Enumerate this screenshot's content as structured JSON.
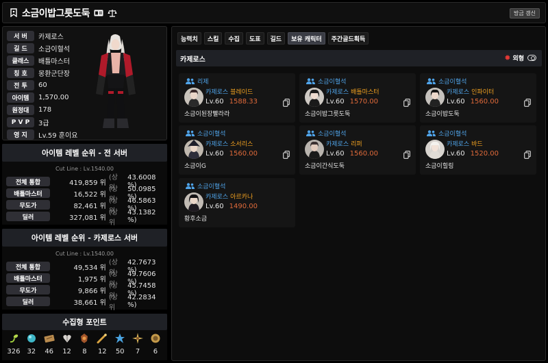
{
  "header": {
    "title": "소금이밥그릇도둑",
    "update_label": "방금 갱신"
  },
  "profile": {
    "rows": [
      {
        "label": "서 버",
        "value": "카제로스"
      },
      {
        "label": "길 드",
        "value": "소금이혈석"
      },
      {
        "label": "클래스",
        "value": "배틀마스터"
      },
      {
        "label": "칭 호",
        "value": "몽환군단장"
      },
      {
        "label": "전 투",
        "value": "60"
      },
      {
        "label": "아이템",
        "value": "1,570.00"
      },
      {
        "label": "원정대",
        "value": "178"
      },
      {
        "label": "P V P",
        "value": "3급"
      },
      {
        "label": "영 지",
        "value": "Lv.59 훈이요"
      }
    ]
  },
  "rank_all": {
    "title": "아이템 레벨 순위 - 전 서버",
    "cutline": "Cut Line : Lv.1540.00",
    "rows": [
      {
        "label": "전체 통합",
        "value": "419,859 위",
        "pre": "(상위",
        "pct": "43.6008 %)"
      },
      {
        "label": "배틀마스터",
        "value": "16,522 위",
        "pre": "(상위",
        "pct": "50.0985 %)"
      },
      {
        "label": "무도가",
        "value": "82,461 위",
        "pre": "(상위",
        "pct": "46.5863 %)"
      },
      {
        "label": "딜러",
        "value": "327,081 위",
        "pre": "(상위",
        "pct": "43.1382 %)"
      }
    ]
  },
  "rank_server": {
    "title": "아이템 레벨 순위 - 카제로스 서버",
    "cutline": "Cut Line : Lv.1540.00",
    "rows": [
      {
        "label": "전체 통합",
        "value": "49,534 위",
        "pre": "(상위",
        "pct": "42.7673 %)"
      },
      {
        "label": "배틀마스터",
        "value": "1,975 위",
        "pre": "(상위",
        "pct": "49.7606 %)"
      },
      {
        "label": "무도가",
        "value": "9,866 위",
        "pre": "(상위",
        "pct": "45.7458 %)"
      },
      {
        "label": "딜러",
        "value": "38,661 위",
        "pre": "(상위",
        "pct": "42.2834 %)"
      }
    ]
  },
  "collection": {
    "title": "수집형 포인트",
    "items": [
      {
        "icon": "mokoko-seed-icon",
        "count": "326"
      },
      {
        "icon": "island-soul-icon",
        "count": "32"
      },
      {
        "icon": "art-icon",
        "count": "46"
      },
      {
        "icon": "giant-heart-icon",
        "count": "12"
      },
      {
        "icon": "ignea-token-icon",
        "count": "8"
      },
      {
        "icon": "sea-bounty-icon",
        "count": "12"
      },
      {
        "icon": "world-tree-leaf-icon",
        "count": "50"
      },
      {
        "icon": "orpheus-star-icon",
        "count": "7"
      },
      {
        "icon": "omnium-star-icon",
        "count": "6"
      }
    ]
  },
  "tabs": [
    "능력치",
    "스킬",
    "수집",
    "도표",
    "길드",
    "보유 캐릭터",
    "주간골드획득"
  ],
  "server_bar": {
    "name": "카제로스",
    "ext_label": "외형"
  },
  "characters": [
    {
      "guild": "리제",
      "server": "카제로스",
      "class": "블레이드",
      "level": "Lv.60",
      "ilvl": "1588.33",
      "name": "소금이된장빨라라",
      "portrait": "#c9c3bb"
    },
    {
      "guild": "소금이혈석",
      "server": "카제로스",
      "class": "배틀마스터",
      "level": "Lv.60",
      "ilvl": "1570.00",
      "name": "소금이밥그릇도둑",
      "portrait": "#cfcac4"
    },
    {
      "guild": "소금이혈석",
      "server": "카제로스",
      "class": "인파이터",
      "level": "Lv.60",
      "ilvl": "1560.00",
      "name": "소금이밥도둑",
      "portrait": "#c6c2bd"
    },
    {
      "guild": "소금이혈석",
      "server": "카제로스",
      "class": "소서리스",
      "level": "Lv.60",
      "ilvl": "1560.00",
      "name": "소금이G",
      "portrait": "#c0b8ae"
    },
    {
      "guild": "소금이혈석",
      "server": "카제로스",
      "class": "리퍼",
      "level": "Lv.60",
      "ilvl": "1560.00",
      "name": "소금이간식도둑",
      "portrait": "#b9b4ae"
    },
    {
      "guild": "소금이혈석",
      "server": "카제로스",
      "class": "바드",
      "level": "Lv.60",
      "ilvl": "1520.00",
      "name": "소금이힐링",
      "portrait": "#d8d4cf"
    },
    {
      "guild": "소금이혈석",
      "server": "카제로스",
      "class": "아르카나",
      "level": "Lv.60",
      "ilvl": "1490.00",
      "name": "황후소금",
      "portrait": "#c2bcb5"
    }
  ],
  "colors": {
    "guild_blue": "#4fa3e8",
    "class_orange": "#f0a020",
    "ilvl_orange": "#e06a3a",
    "active_tab": "#3a3c44"
  }
}
